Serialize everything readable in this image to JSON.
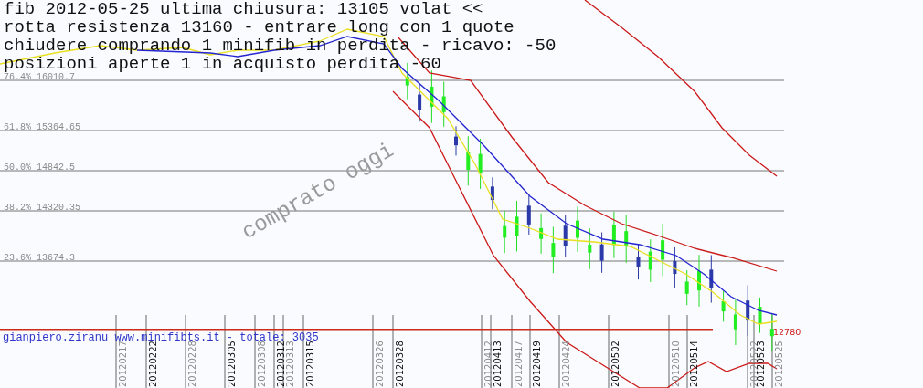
{
  "header_lines": [
    "fib 2012-05-25 ultima chiusura: 13105 volat <<",
    "rotta resistenza 13160 - entrare long con 1 quote",
    "chiudere comprando 1 minifib in perdita - ricavo: -50",
    "posizioni aperte 1 in acquisto perdita -60"
  ],
  "fib_levels": [
    {
      "label": "76.4% 16010.7"
    },
    {
      "label": "61.8% 15364.65"
    },
    {
      "label": "50.0% 14842.5"
    },
    {
      "label": "38.2% 14320.35"
    },
    {
      "label": "23.6% 13674.3"
    }
  ],
  "annotation": "comprato oggi",
  "price_label": "12780",
  "footer": "gianpiero.ziranu www.minifibts.it - totale: 3035",
  "dates": [
    {
      "label": "20120217",
      "emphasized": false
    },
    {
      "label": "20120222",
      "emphasized": true
    },
    {
      "label": "20120228",
      "emphasized": false
    },
    {
      "label": "20120305",
      "emphasized": true
    },
    {
      "label": "20120308",
      "emphasized": false
    },
    {
      "label": "20120312",
      "emphasized": true
    },
    {
      "label": "20120313",
      "emphasized": false
    },
    {
      "label": "20120315",
      "emphasized": true
    },
    {
      "label": "20120326",
      "emphasized": false
    },
    {
      "label": "20120328",
      "emphasized": true
    },
    {
      "label": "20120412",
      "emphasized": false
    },
    {
      "label": "20120413",
      "emphasized": true
    },
    {
      "label": "20120417",
      "emphasized": false
    },
    {
      "label": "20120419",
      "emphasized": true
    },
    {
      "label": "20120424",
      "emphasized": false
    },
    {
      "label": "20120502",
      "emphasized": true
    },
    {
      "label": "20120510",
      "emphasized": false
    },
    {
      "label": "20120514",
      "emphasized": true
    },
    {
      "label": "20120522",
      "emphasized": false
    },
    {
      "label": "20120523",
      "emphasized": true
    },
    {
      "label": "20120525",
      "emphasized": false
    }
  ]
}
